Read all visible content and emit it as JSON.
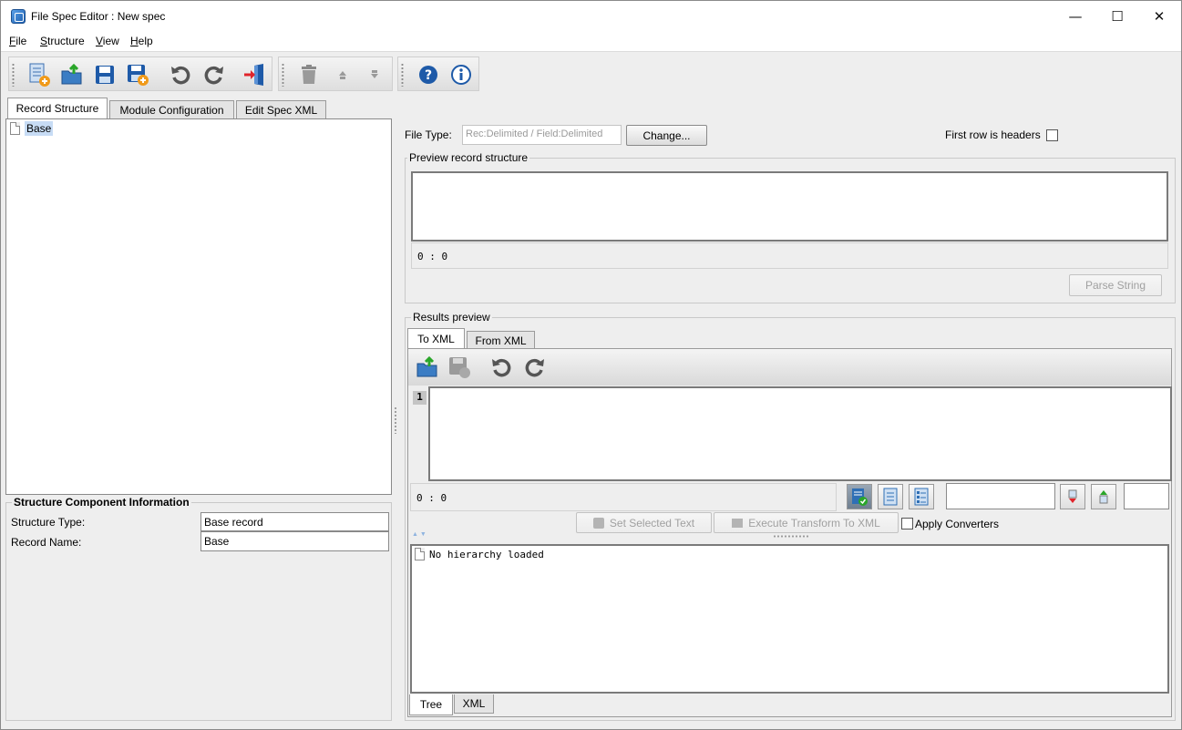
{
  "window": {
    "title": "File Spec Editor : New spec",
    "minimize": "—",
    "maximize": "☐",
    "close": "✕"
  },
  "menu": [
    {
      "label_u": "F",
      "label_rest": "ile"
    },
    {
      "label_u": "S",
      "label_rest": "tructure"
    },
    {
      "label_u": "V",
      "label_rest": "iew"
    },
    {
      "label_u": "H",
      "label_rest": "elp"
    }
  ],
  "toolbar_icons": [
    "new-spec-icon",
    "open-icon",
    "save-icon",
    "save-as-icon",
    "undo-icon",
    "redo-icon",
    "exit-icon",
    "delete-icon",
    "move-up-icon",
    "move-down-icon",
    "help-icon",
    "info-icon"
  ],
  "tabs": [
    "Record Structure",
    "Module Configuration",
    "Edit Spec XML"
  ],
  "tree": {
    "root": "Base"
  },
  "structure_info": {
    "title": "Structure Component Information",
    "type_label": "Structure Type:",
    "type_value": "Base record",
    "name_label": "Record Name:",
    "name_value": "Base"
  },
  "file_type": {
    "label": "File Type:",
    "value": "Rec:Delimited / Field:Delimited",
    "change_button": "Change...",
    "first_row_label": "First row is headers"
  },
  "preview": {
    "title": "Preview record structure",
    "cursor": "0 : 0",
    "parse_button": "Parse String"
  },
  "results": {
    "title": "Results preview",
    "tabs": [
      "To XML",
      "From XML"
    ],
    "line_number": "1",
    "cursor": "0 : 0",
    "set_selected_text": "Set Selected Text",
    "execute_transform": "Execute Transform To XML",
    "apply_converters": "Apply Converters",
    "hierarchy_text": "No hierarchy loaded",
    "bottom_tabs": [
      "Tree",
      "XML"
    ]
  },
  "colors": {
    "selection": "#c7dcf5",
    "accent_blue": "#1c5fb0",
    "exit_red": "#e0242b"
  }
}
